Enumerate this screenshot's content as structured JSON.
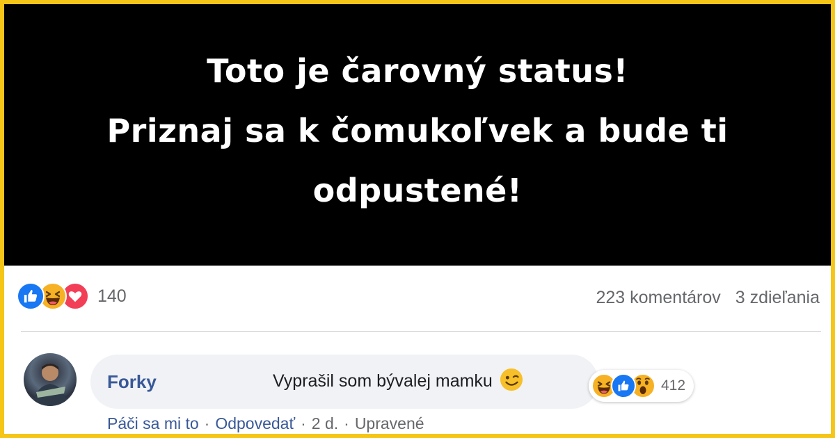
{
  "status": {
    "lines": [
      "Toto je čarovný status!",
      "Priznaj sa k čomukoľvek a bude ti",
      "odpustené!"
    ],
    "background": "#000000",
    "text_color": "#ffffff"
  },
  "post": {
    "reactions": [
      "like-icon",
      "haha-icon",
      "love-icon"
    ],
    "reactions_count": "140",
    "comments_count": "223 komentárov",
    "shares_count": "3 zdieľania"
  },
  "comment": {
    "author": "Forky",
    "text": "Vyprašil som bývalej mamku",
    "emoji": "wink-emoji-icon",
    "reactions": [
      "haha-icon",
      "like-icon",
      "wow-icon"
    ],
    "reactions_count": "412",
    "actions": {
      "like": "Páči sa mi to",
      "reply": "Odpovedať",
      "time": "2 d.",
      "edited": "Upravené",
      "separator": "·"
    }
  },
  "colors": {
    "frame_border": "#f5c518",
    "link_blue": "#385898",
    "meta_gray": "#65676b",
    "bubble_bg": "#f0f2f5",
    "like_blue": "#1877f2",
    "haha_yellow": "#f7b125",
    "love_red": "#f33e58"
  }
}
